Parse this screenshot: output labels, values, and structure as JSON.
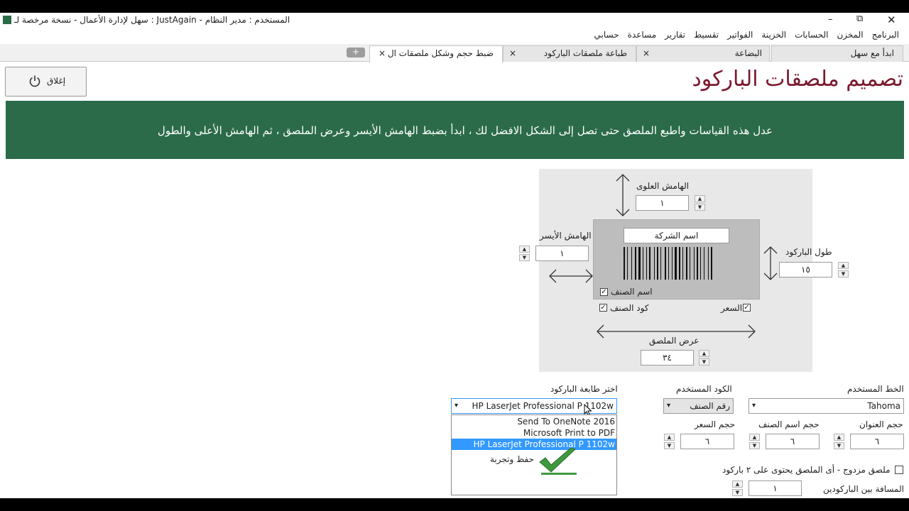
{
  "window": {
    "title": "سهل لإدارة الأعمال  -  نسخة مرخصة لـ : JustAgain  -  المستخدم : مدير النظام"
  },
  "window_controls": {
    "minimize": "–",
    "restore": "⧉",
    "close": "✕"
  },
  "menu": [
    "البرنامج",
    "المخزن",
    "الحسابات",
    "الخزينة",
    "الفواتير",
    "تقسيط",
    "تقارير",
    "مساعدة",
    "حسابي"
  ],
  "tabs": [
    {
      "label": "ابدأ مع سهل",
      "active": false,
      "closable": false
    },
    {
      "label": "البضاعة",
      "active": false,
      "closable": true
    },
    {
      "label": "طباعة ملصقات الباركود",
      "active": false,
      "closable": true
    },
    {
      "label": "ضبط حجم وشكل ملصقات ال",
      "active": true,
      "closable": true
    }
  ],
  "tab_close_glyph": "×",
  "new_tab_glyph": "+",
  "close_button": {
    "label": "إغلاق",
    "icon": "power-icon"
  },
  "page_title": "تصميم ملصقات الباركود",
  "banner_text": "عدل هذه القياسات واطبع الملصق حتى تصل إلى الشكل الافضل لك ، ابدأ بضبط الهامش الأيسر وعرض الملصق ، ثم الهامش الأعلى والطول",
  "designer": {
    "top_margin": {
      "label": "الهامش العلوى",
      "value": "١"
    },
    "left_margin": {
      "label": "الهامش الأيسر",
      "value": "١"
    },
    "barcode_height": {
      "label": "طول الباركود",
      "value": "١٥"
    },
    "label_width": {
      "label": "عرض الملصق",
      "value": "٣٤"
    },
    "company_name": "اسم الشركة",
    "item_name": {
      "label": "اسم الصنف",
      "checked": true
    },
    "item_code": {
      "label": "كود الصنف",
      "checked": true
    },
    "price": {
      "label": "السعر",
      "checked": true
    }
  },
  "settings": {
    "font": {
      "label": "الخط المستخدم",
      "value": "Tahoma"
    },
    "code": {
      "label": "الكود المستخدم",
      "value": "رقم الصنف"
    },
    "printer": {
      "label": "اختر طابعة الباركود",
      "value": "HP LaserJet Professional P 1102w",
      "options": [
        "Send To OneNote 2016",
        "Microsoft Print to PDF",
        "HP LaserJet Professional P 1102w"
      ],
      "selected_index": 2
    },
    "title_size": {
      "label": "حجم العنوان",
      "value": "٦"
    },
    "item_name_size": {
      "label": "حجم اسم الصنف",
      "value": "٦"
    },
    "price_size": {
      "label": "حجم السعر",
      "value": "٦"
    },
    "double_label": {
      "label": "ملصق مزدوج - أى الملصق يحتوى على ٢ باركود",
      "checked": false
    },
    "barcode_gap": {
      "label": "المسافة بين الباركودين",
      "value": "١"
    },
    "save_test": {
      "label": "حفظ وتجربة",
      "icon": "checkmark-icon"
    }
  },
  "colors": {
    "banner": "#2b6b4a",
    "title": "#7a1a2e",
    "selection": "#3399ff"
  }
}
